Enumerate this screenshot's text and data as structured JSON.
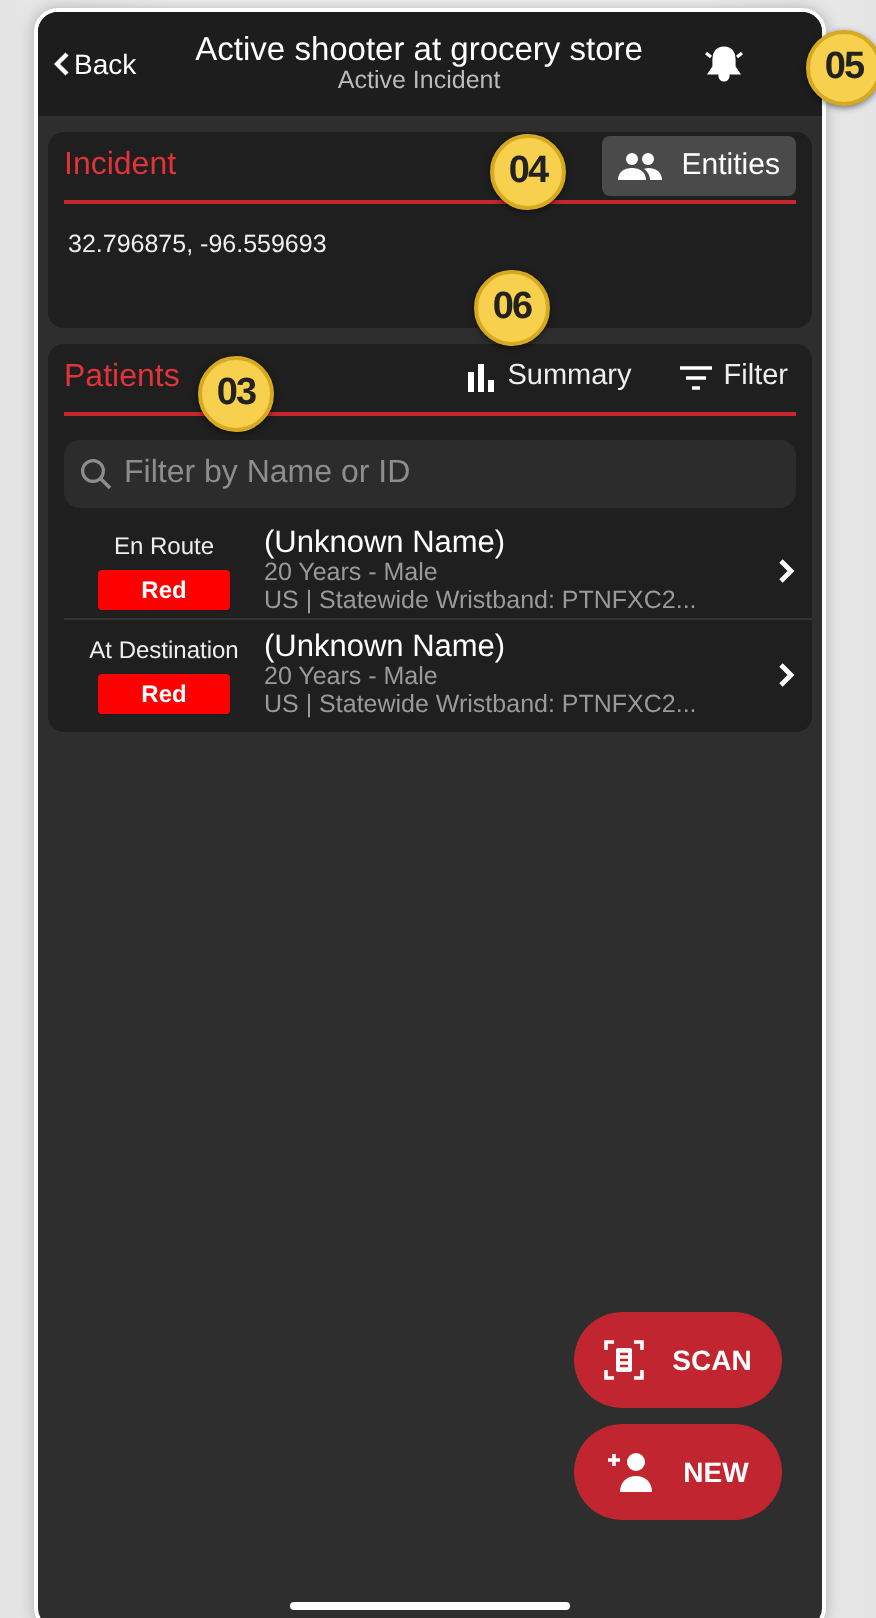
{
  "header": {
    "back": "Back",
    "title": "Active shooter at grocery store",
    "subtitle": "Active Incident"
  },
  "incident": {
    "heading": "Incident",
    "entities_button": "Entities",
    "coordinates": "32.796875, -96.559693"
  },
  "patients": {
    "heading": "Patients",
    "summary_button": "Summary",
    "filter_button": "Filter",
    "search": {
      "placeholder": "Filter by Name or ID"
    },
    "rows": [
      {
        "status": "En Route",
        "triage": "Red",
        "color": "#ff0000",
        "name": "(Unknown Name)",
        "age_sex": "20 Years - Male",
        "identifier": "US | Statewide Wristband: PTNFXC2..."
      },
      {
        "status": "At Destination",
        "triage": "Red",
        "color": "#ff0000",
        "name": "(Unknown Name)",
        "age_sex": "20 Years - Male",
        "identifier": "US | Statewide Wristband: PTNFXC2..."
      }
    ]
  },
  "actions": [
    {
      "kind": "scan",
      "label": "SCAN"
    },
    {
      "kind": "new",
      "label": "NEW"
    }
  ],
  "callouts": [
    {
      "kind": "alerts",
      "label": "05"
    },
    {
      "kind": "entities",
      "label": "04"
    },
    {
      "kind": "coordinates",
      "label": "06"
    },
    {
      "kind": "patients",
      "label": "03"
    }
  ]
}
